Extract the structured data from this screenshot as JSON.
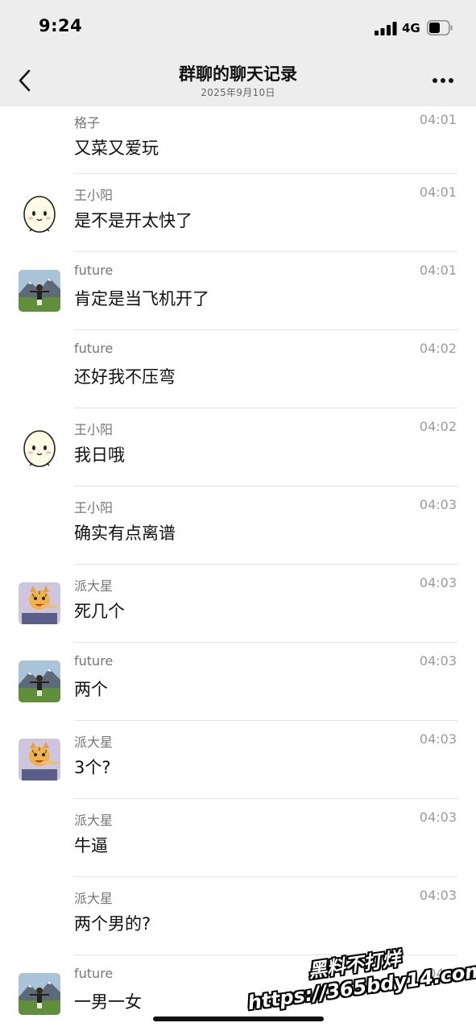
{
  "status_bar": {
    "time": "9:24",
    "network": "4G"
  },
  "nav": {
    "title": "群聊的聊天记录",
    "subtitle": "2025年9月10日"
  },
  "messages": [
    {
      "sender": "格子",
      "time": "04:01",
      "text": "又菜又爱玩",
      "avatar": "none"
    },
    {
      "sender": "王小阳",
      "time": "04:01",
      "text": "是不是开太快了",
      "avatar": "egg-avatar"
    },
    {
      "sender": "future",
      "time": "04:01",
      "text": "肯定是当飞机开了",
      "avatar": "mountain-avatar"
    },
    {
      "sender": "future",
      "time": "04:02",
      "text": "还好我不压弯",
      "avatar": "none"
    },
    {
      "sender": "王小阳",
      "time": "04:02",
      "text": "我日哦",
      "avatar": "egg-avatar"
    },
    {
      "sender": "王小阳",
      "time": "04:03",
      "text": "确实有点离谱",
      "avatar": "none"
    },
    {
      "sender": "派大星",
      "time": "04:03",
      "text": "死几个",
      "avatar": "cat-avatar"
    },
    {
      "sender": "future",
      "time": "04:03",
      "text": "两个",
      "avatar": "mountain-avatar"
    },
    {
      "sender": "派大星",
      "time": "04:03",
      "text": "3个?",
      "avatar": "cat-avatar"
    },
    {
      "sender": "派大星",
      "time": "04:03",
      "text": "牛逼",
      "avatar": "none"
    },
    {
      "sender": "派大星",
      "time": "04:03",
      "text": "两个男的?",
      "avatar": "none"
    },
    {
      "sender": "future",
      "time": "04:0",
      "text": "一男一女",
      "avatar": "mountain-avatar"
    }
  ],
  "watermark": {
    "line1": "黑料不打烊",
    "line2": "https://365bdy14.com"
  },
  "colors": {
    "header_bg": "#ededed",
    "sender": "#767676",
    "time": "#9a9a9a",
    "separator": "#e3e3e3"
  }
}
